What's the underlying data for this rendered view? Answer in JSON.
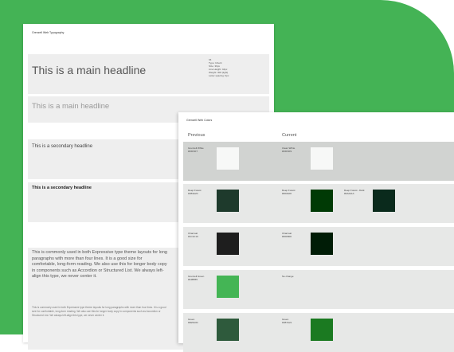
{
  "colors": {
    "background": "#44b355"
  },
  "typography_sheet": {
    "title": "Grenzell Web Typography",
    "h1": "This is a main headline",
    "h1_light": "This is a main headline",
    "h2": "This is a secondary headline",
    "h2_bold": "This is a secondary headline",
    "paragraph": "This is commonly used in both Expressive type theme layouts for long paragraphs with more than four lines. It is a good size for comfortable, long-form reading. We also use this for longer body copy in components such as Accordion or Structured List. We always left-align this type, we never center it.",
    "small_paragraph": "This is commonly used in both Expressive type theme layouts for long paragraphs with more than four lines. It is a good size for comfortable, long-form reading. We also use this for longer body copy in components such as Accordion or Structured List. We always left-align this type, we never center it.",
    "specs": [
      "h6",
      "Type: Inherit",
      "Size: 36px",
      "Line Height: 44px",
      "Weight: 300 (light)",
      "Letter spacing: 0px"
    ]
  },
  "colors_sheet": {
    "title": "Grenzell Web Colors",
    "previous_label": "Previous",
    "current_label": "Current",
    "rows": [
      {
        "cells": [
          {
            "label": [
              "Grenzell White",
              "#F6F6F7"
            ],
            "color": "#f7f8f7"
          },
          {
            "label": [
              "Clean White",
              "#F6F6F9"
            ],
            "color": "#f7f8f7"
          }
        ]
      },
      {
        "cells": [
          {
            "label": [
              "Deep Forest",
              "#1B3A2C"
            ],
            "color": "#1e3a2c"
          },
          {
            "label": [
              "Deep Forest",
              "#003A00"
            ],
            "color": "#003a05"
          },
          {
            "label": [
              "Deep Forest - Dark",
              "#0A2A1A"
            ],
            "color": "#0a2a1c"
          }
        ]
      },
      {
        "cells": [
          {
            "label": [
              "Charcoal",
              "#1C1C1C"
            ],
            "color": "#1e1e1e"
          },
          {
            "label": [
              "Charcoal",
              "#001B00"
            ],
            "color": "#001c06"
          }
        ]
      },
      {
        "cells": [
          {
            "label": [
              "Grenzell Green",
              "#44B555"
            ],
            "color": "#44b555"
          },
          {
            "label": [
              "No change"
            ],
            "color": ""
          }
        ]
      },
      {
        "cells": [
          {
            "label": [
              "Green",
              "#2E5A3C"
            ],
            "color": "#2e5a3c"
          },
          {
            "label": [
              "Green",
              "#1B7A21"
            ],
            "color": "#1b7a21"
          }
        ]
      }
    ]
  }
}
